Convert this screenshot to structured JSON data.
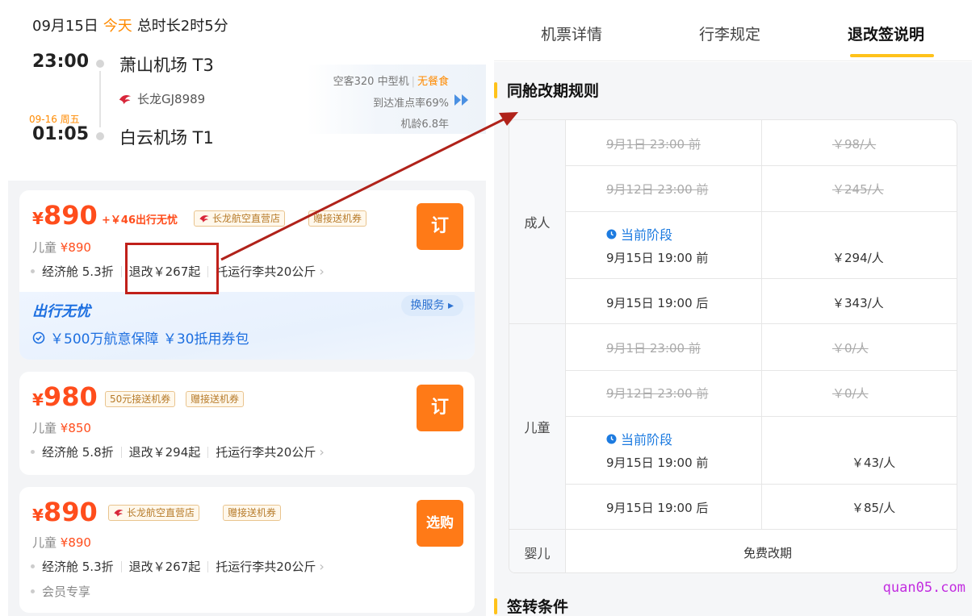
{
  "flight": {
    "date": "09月15日",
    "today": "今天",
    "duration": "总时长2时5分",
    "dep_time": "23:00",
    "dep_airport": "萧山机场 T3",
    "airline": "长龙GJ8989",
    "arr_date": "09-16 周五",
    "arr_time": "01:05",
    "arr_airport": "白云机场 T1",
    "aircraft": "空客320 中型机",
    "meal": "无餐食",
    "ontime": "到达准点率69%",
    "age": "机龄6.8年"
  },
  "offers": [
    {
      "yen": "¥",
      "price": "890",
      "extra": "+￥46出行无忧",
      "store_tag": "长龙航空直营店",
      "gift_tag": "赠接送机券",
      "child_label": "儿童",
      "child_price": "¥890",
      "cabin": "经济舱 5.3折",
      "refund": "退改￥267起",
      "baggage": "托运行李共20公斤",
      "book_label": "订",
      "worry_title": "出行无忧",
      "swap_label": "换服务",
      "worry_desc": "￥500万航意保障 ￥30抵用券包"
    },
    {
      "yen": "¥",
      "price": "980",
      "tag1": "50元接送机券",
      "tag2": "赠接送机券",
      "child_label": "儿童",
      "child_price": "¥850",
      "cabin": "经济舱 5.8折",
      "refund": "退改￥294起",
      "baggage": "托运行李共20公斤",
      "book_label": "订"
    },
    {
      "yen": "¥",
      "price": "890",
      "store_tag": "长龙航空直营店",
      "gift_tag": "赠接送机券",
      "child_label": "儿童",
      "child_price": "¥890",
      "cabin": "经济舱 5.3折",
      "refund": "退改￥267起",
      "baggage": "托运行李共20公斤",
      "book_label": "选购",
      "member": "会员专享"
    }
  ],
  "tabs": [
    "机票详情",
    "行李规定",
    "退改签说明"
  ],
  "section_titles": {
    "change_rules": "同舱改期规则",
    "transfer": "签转条件"
  },
  "rules": {
    "adult_label": "成人",
    "child_label": "儿童",
    "infant_label": "婴儿",
    "current_stage": "当前阶段",
    "adult": [
      {
        "time": "9月1日 23:00 前",
        "fee": "￥98/人"
      },
      {
        "time": "9月12日 23:00 前",
        "fee": "￥245/人"
      },
      {
        "time": "9月15日 19:00 前",
        "fee": "￥294/人"
      },
      {
        "time": "9月15日 19:00 后",
        "fee": "￥343/人"
      }
    ],
    "child": [
      {
        "time": "9月1日 23:00 前",
        "fee": "￥0/人"
      },
      {
        "time": "9月12日 23:00 前",
        "fee": "￥0/人"
      },
      {
        "time": "9月15日 19:00 前",
        "fee": "￥43/人"
      },
      {
        "time": "9月15日 19:00 后",
        "fee": "￥85/人"
      }
    ],
    "infant": "免费改期"
  },
  "colors": {
    "accent_orange": "#ff7a17",
    "price_red": "#ff4d1c",
    "tab_yellow": "#ffc21a",
    "blue": "#1d6fe0",
    "annotation_red": "#c0201a"
  },
  "watermark": "quan05.com"
}
